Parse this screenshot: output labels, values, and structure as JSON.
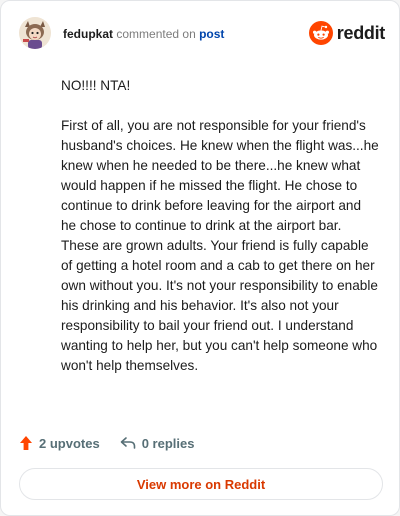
{
  "header": {
    "username": "fedupkat",
    "verb": "commented on",
    "target": "post",
    "brand_name": "reddit",
    "brand_color": "#ff4500",
    "avatar_icon": "avatar-illustration-icon",
    "brand_icon": "reddit-snoo-icon"
  },
  "comment": {
    "headline": "NO!!!! NTA!",
    "paragraph": "First of all, you are not responsible for your friend's husband's choices. He knew when the flight was...he knew when he needed to be there...he knew what would happen if he missed the flight. He chose to continue to drink before leaving for the airport and he chose to continue to drink at the airport bar. These are grown adults. Your friend is fully capable of getting a hotel room and a cab to get there on her own without you. It's not your responsibility to enable his drinking and his behavior. It's also not your responsibility to bail your friend out. I understand wanting to help her, but you can't help someone who won't help themselves."
  },
  "actions": {
    "upvotes_label": "2 upvotes",
    "replies_label": "0 replies",
    "upvote_icon": "upvote-arrow-icon",
    "reply_icon": "reply-arrow-icon"
  },
  "cta": {
    "label": "View more on Reddit"
  }
}
